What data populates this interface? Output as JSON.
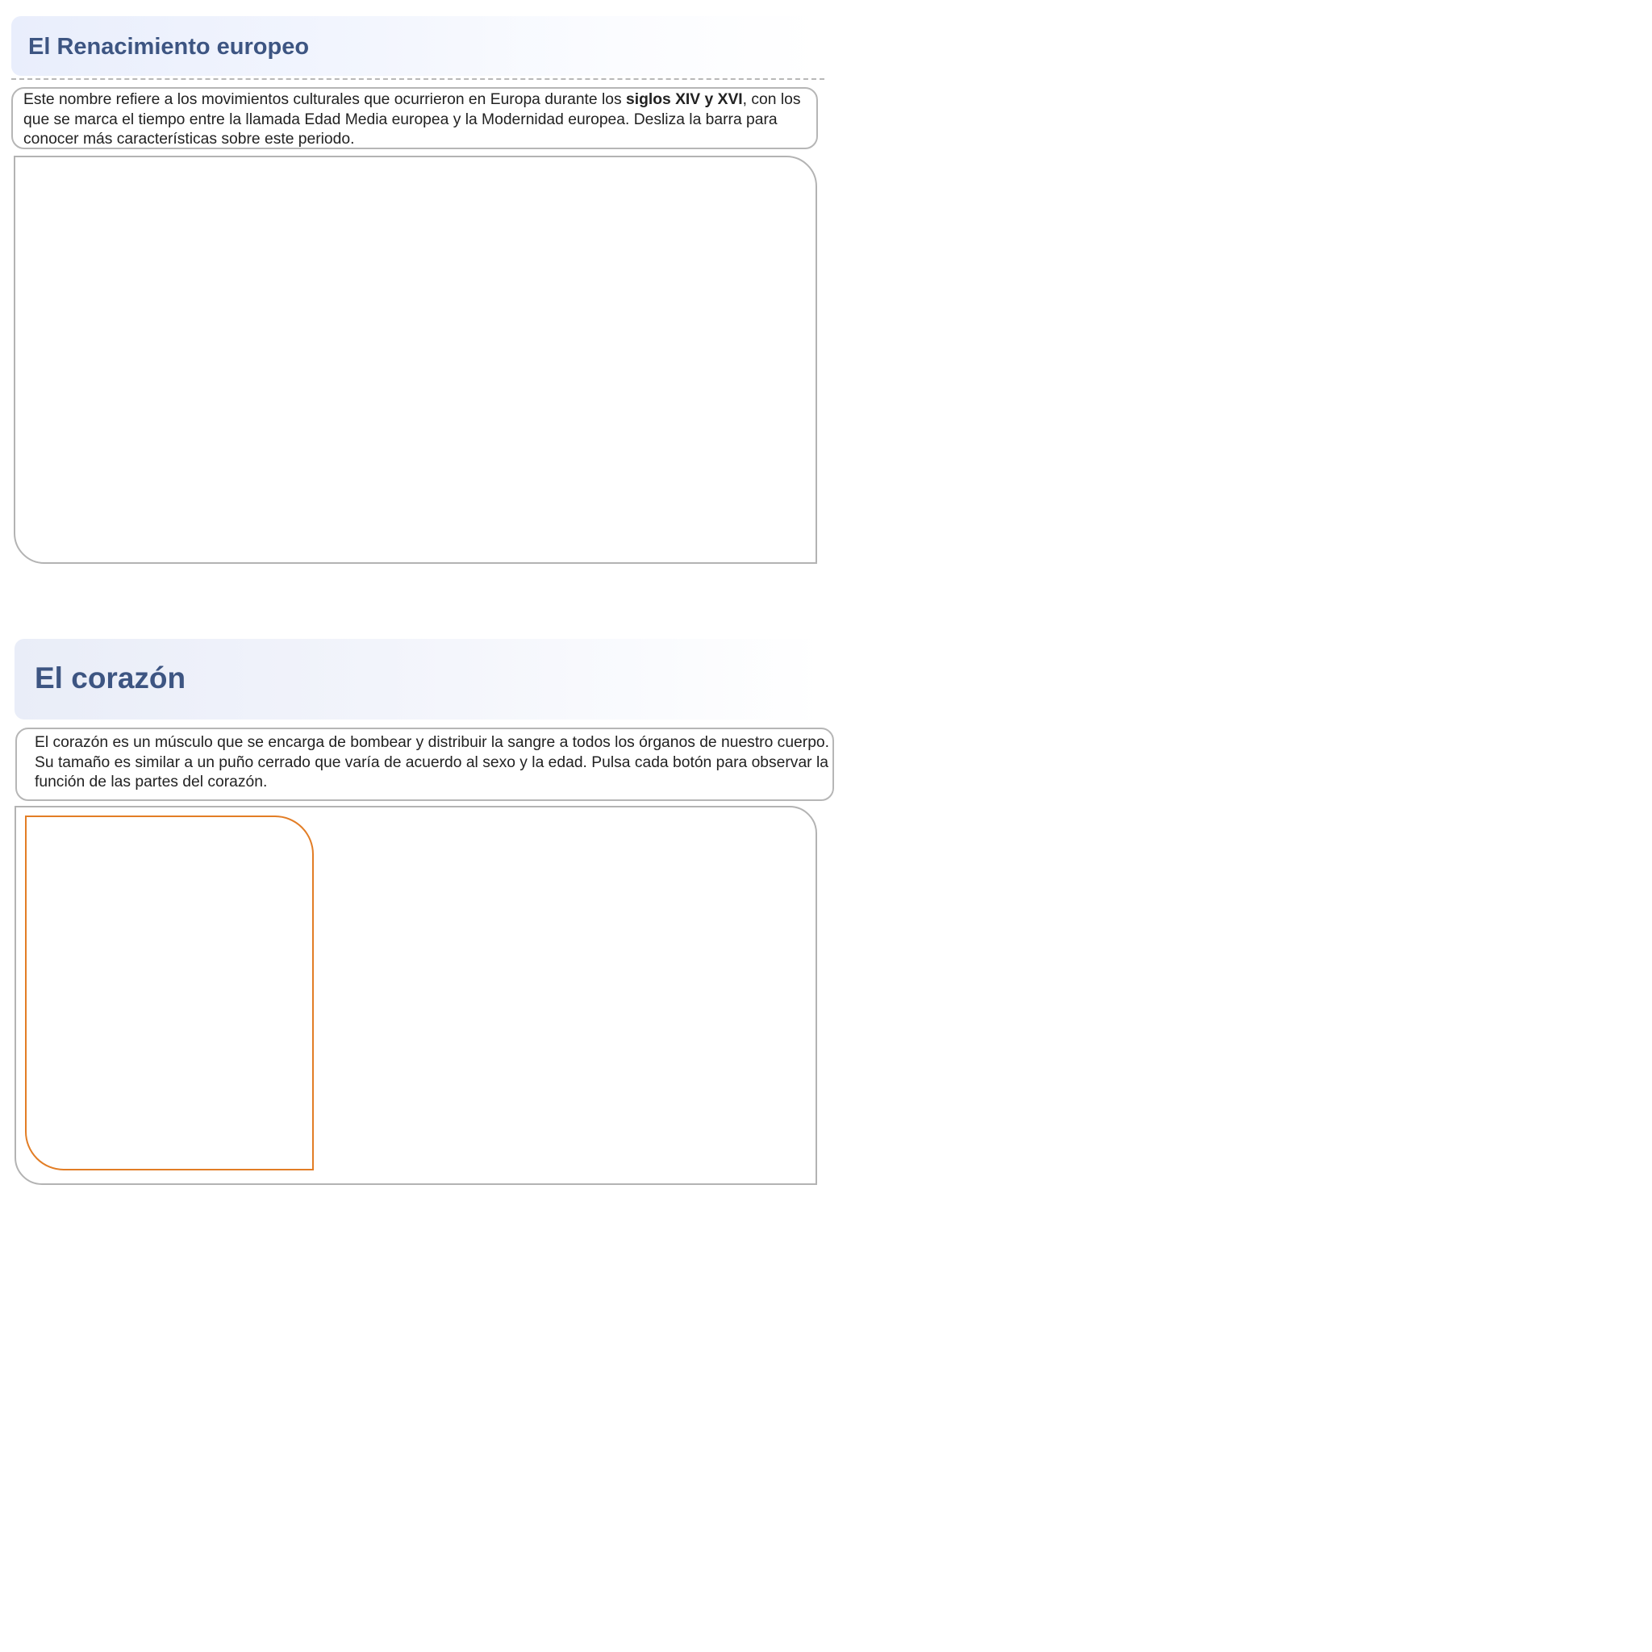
{
  "renacimiento": {
    "title": "El Renacimiento europeo",
    "description": {
      "text_before": "Este nombre refiere a los movimientos culturales que ocurrieron en Europa durante los ",
      "bold": "siglos XIV y XVI",
      "text_after": ", con los que se marca el tiempo entre la llamada Edad Media europea y la Modernidad europea. Desliza la barra para conocer más características sobre este periodo."
    }
  },
  "corazon": {
    "title": "El corazón",
    "description": "El corazón es un músculo que se encarga de bombear y distribuir la sangre a todos los órganos de nuestro cuerpo. Su tamaño es similar a un puño cerrado que varía de acuerdo al sexo y la edad. Pulsa cada botón para observar la función de las partes del corazón."
  },
  "colors": {
    "title": "#3d5582",
    "border": "#b3b3b3",
    "accent_frame": "#e27d25",
    "header_gradient_start": "#e9eefc"
  }
}
